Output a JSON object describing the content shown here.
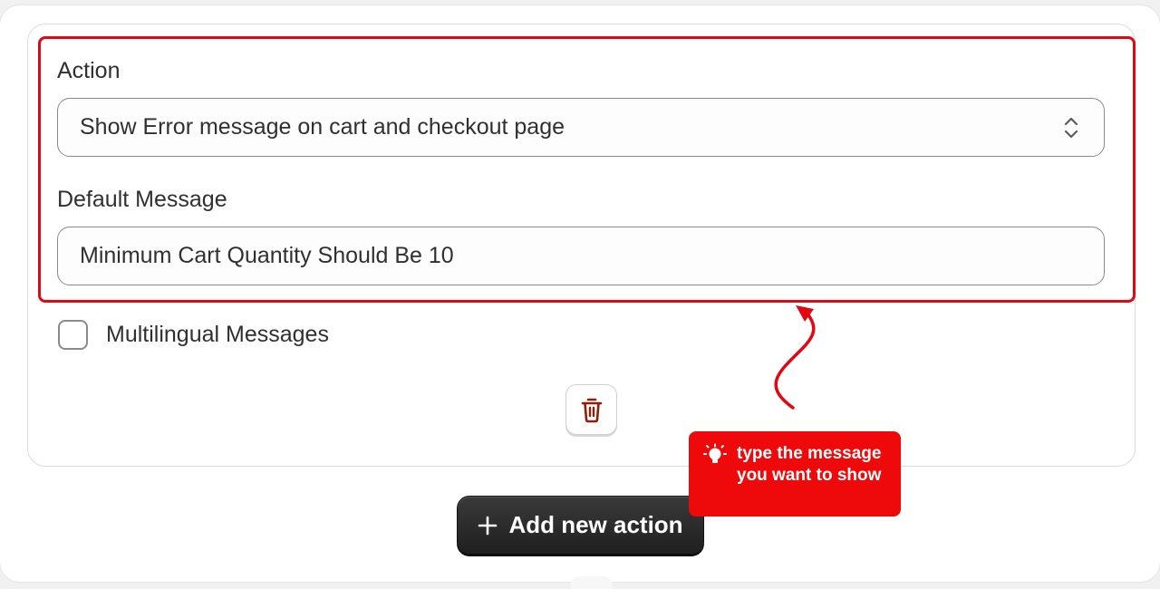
{
  "action": {
    "label": "Action",
    "selected_value": "Show Error message on cart and checkout page",
    "icon": "chevron-up-down-icon"
  },
  "default_message": {
    "label": "Default Message",
    "value": "Minimum Cart Quantity Should Be 10"
  },
  "multilingual": {
    "label": "Multilingual Messages",
    "checked": false
  },
  "delete_button": {
    "icon": "trash-icon",
    "color": "#8e1f0b"
  },
  "add_button": {
    "label": "Add new action",
    "icon": "plus-icon"
  },
  "tooltip": {
    "text": "type the message you want to show",
    "icon": "lightbulb-icon",
    "color": "#ee0a0a"
  },
  "highlight_color": "#e30613"
}
